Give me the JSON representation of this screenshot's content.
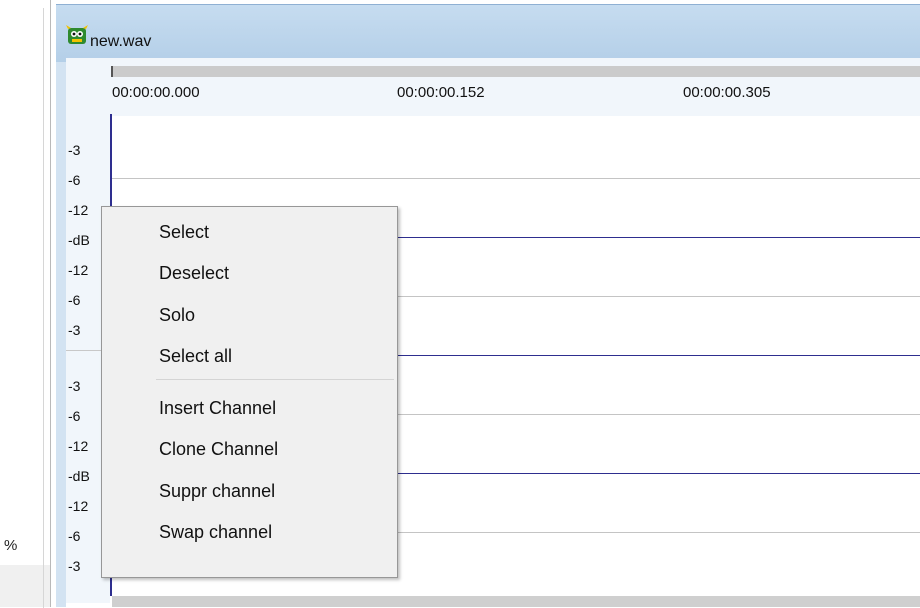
{
  "left_pane": {
    "percent_label": "%"
  },
  "window": {
    "title": "new.wav",
    "icon": "app-monster-icon"
  },
  "ruler": {
    "ticks": [
      "00:00:00.000",
      "00:00:00.152",
      "00:00:00.305"
    ]
  },
  "db_scale": {
    "channel1": [
      "-3",
      "-6",
      "-12",
      "-dB",
      "-12",
      "-6",
      "-3"
    ],
    "channel2": [
      "-3",
      "-6",
      "-12",
      "-dB",
      "-12",
      "-6",
      "-3"
    ]
  },
  "context_menu": {
    "items": [
      "Select",
      "Deselect",
      "Solo",
      "Select all",
      "Insert Channel",
      "Clone Channel",
      "Suppr channel",
      "Swap channel"
    ]
  },
  "colors": {
    "titlebar": "#b4cfe8",
    "waveform_line": "#2e2e8f",
    "menu_bg": "#f0f0f0"
  }
}
